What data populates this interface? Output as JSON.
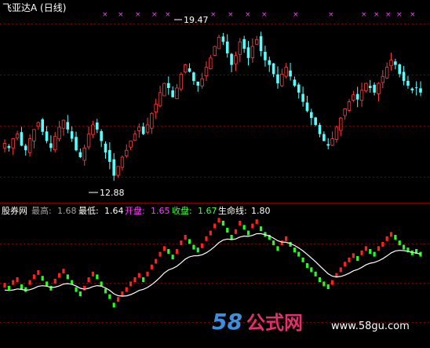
{
  "top_panel": {
    "title": "飞亚达A (日线)",
    "high_label": "19.47",
    "low_label": "12.88"
  },
  "bottom_panel": {
    "indicator_name": "股券网",
    "legend": [
      {
        "label": "最高:",
        "value": "1.68",
        "color": "#a0a0a0"
      },
      {
        "label": "最低:",
        "value": "1.64",
        "color": "#ffffff"
      },
      {
        "label": "开盘:",
        "value": "1.65",
        "color": "#ff3cff"
      },
      {
        "label": "收盘:",
        "value": "1.67",
        "color": "#3cff3c"
      },
      {
        "label": "生命线:",
        "value": "1.80",
        "color": "#ffffff"
      }
    ]
  },
  "watermark": {
    "logo_number": "58",
    "logo_text": "公式网",
    "url": "www.58gu.com"
  },
  "colors": {
    "up": "#ff3c3c",
    "down": "#54ffff",
    "markers": "#ff3cff",
    "bar_up": "#ff2020",
    "bar_down": "#20ff20",
    "life_line": "#ffffff"
  },
  "chart_data": [
    {
      "type": "candlestick",
      "title": "飞亚达A (日线)",
      "ylim": [
        12.3,
        20.2
      ],
      "annotations": [
        {
          "text": "19.47",
          "value": 19.47
        },
        {
          "text": "12.88",
          "value": 12.88
        }
      ],
      "close": [
        14.6,
        14.4,
        14.8,
        15.0,
        14.5,
        14.3,
        14.8,
        15.2,
        15.5,
        15.1,
        14.7,
        14.4,
        14.9,
        15.3,
        15.6,
        15.2,
        14.8,
        14.3,
        14.0,
        14.4,
        15.0,
        15.4,
        15.2,
        14.7,
        14.2,
        13.8,
        13.2,
        13.6,
        14.0,
        14.3,
        14.7,
        15.0,
        15.3,
        15.0,
        15.4,
        15.9,
        16.3,
        16.8,
        17.2,
        17.0,
        16.6,
        17.0,
        17.6,
        18.0,
        17.7,
        17.3,
        17.1,
        17.4,
        17.9,
        18.3,
        18.8,
        19.2,
        19.0,
        18.5,
        18.0,
        18.4,
        19.0,
        18.7,
        18.3,
        18.8,
        19.1,
        18.6,
        18.2,
        18.0,
        17.6,
        17.2,
        17.6,
        17.9,
        17.5,
        17.1,
        16.8,
        16.4,
        16.0,
        15.7,
        15.4,
        15.0,
        14.7,
        14.5,
        14.8,
        15.3,
        15.7,
        16.1,
        16.4,
        16.7,
        16.5,
        16.9,
        17.2,
        17.0,
        16.8,
        17.2,
        17.5,
        17.9,
        18.2,
        18.0,
        17.6,
        17.3,
        17.1,
        16.9,
        17.0,
        16.8
      ],
      "up_days_marked": "red candles rise, cyan candles fall"
    },
    {
      "type": "bar",
      "name": "股券网",
      "legend": [
        "最高 1.68",
        "最低 1.64",
        "开盘 1.65",
        "收盘 1.67",
        "生命线 1.80"
      ]
    }
  ]
}
